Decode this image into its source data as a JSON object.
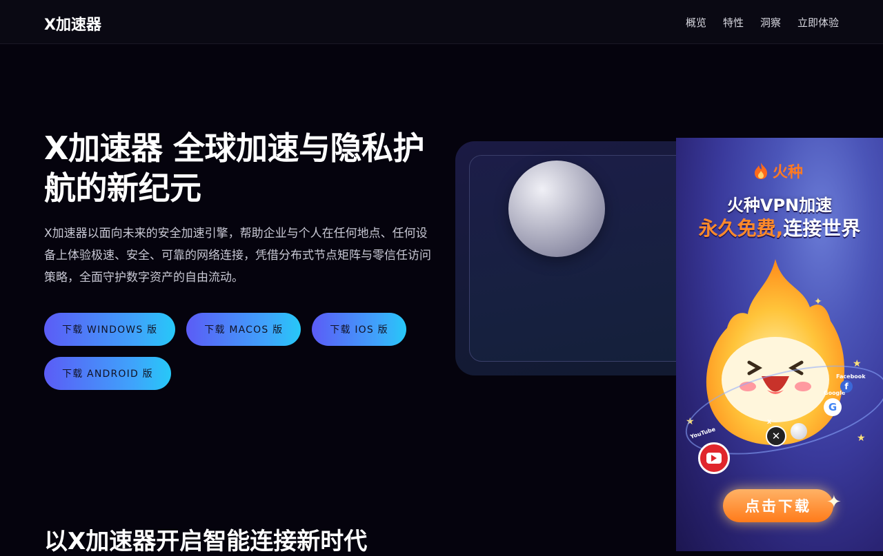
{
  "navbar": {
    "brand": "X加速器",
    "links": [
      "概览",
      "特性",
      "洞察",
      "立即体验"
    ]
  },
  "hero": {
    "title": "X加速器 全球加速与隐私护航的新纪元",
    "description": "X加速器以面向未来的安全加速引擎，帮助企业与个人在任何地点、任何设备上体验极速、安全、可靠的网络连接，凭借分布式节点矩阵与零信任访问策略，全面守护数字资产的自由流动。",
    "buttons": [
      "下载 WINDOWS 版",
      "下载 MACOS 版",
      "下载 IOS 版",
      "下载 ANDROID 版"
    ]
  },
  "section": {
    "title": "以X加速器开启智能连接新时代"
  },
  "ad": {
    "brand": "火种",
    "headline": "火种VPN加速",
    "subline_accent": "永久免费,",
    "subline_rest": "连接世界",
    "labels": {
      "youtube": "YouTube",
      "x": "X",
      "google": "Google",
      "facebook": "Facebook"
    },
    "cta": "点击下载"
  },
  "colors": {
    "background": "#05030d",
    "button_gradient_start": "#5b5cf6",
    "button_gradient_end": "#27c8f8",
    "ad_accent": "#ff7a22"
  }
}
